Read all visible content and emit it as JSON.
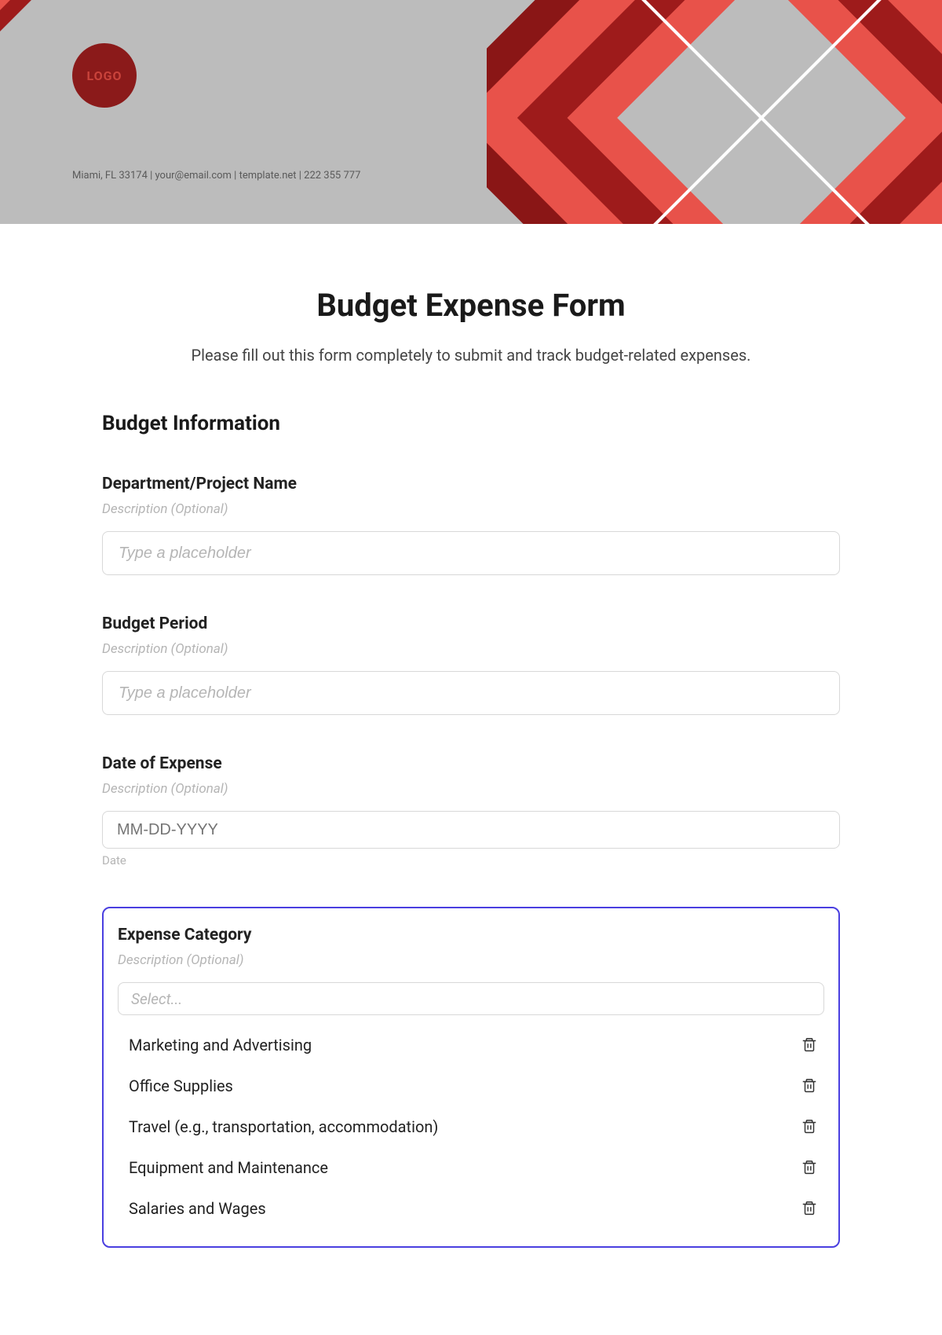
{
  "header": {
    "logo_text": "LOGO",
    "contact_line": "Miami, FL 33174 | your@email.com | template.net | 222 355 777"
  },
  "form": {
    "title": "Budget Expense Form",
    "subtitle": "Please fill out this form completely to submit and track budget-related expenses."
  },
  "section_budget_info": {
    "title": "Budget Information"
  },
  "fields": {
    "dept": {
      "label": "Department/Project Name",
      "desc": "Description (Optional)",
      "placeholder": "Type a placeholder"
    },
    "period": {
      "label": "Budget Period",
      "desc": "Description (Optional)",
      "placeholder": "Type a placeholder"
    },
    "date": {
      "label": "Date of Expense",
      "desc": "Description (Optional)",
      "placeholder": "MM-DD-YYYY",
      "sublabel": "Date"
    },
    "category": {
      "label": "Expense Category",
      "desc": "Description (Optional)",
      "select_placeholder": "Select...",
      "options": [
        "Marketing and Advertising",
        "Office Supplies",
        "Travel (e.g., transportation, accommodation)",
        "Equipment and Maintenance",
        "Salaries and Wages"
      ]
    }
  }
}
